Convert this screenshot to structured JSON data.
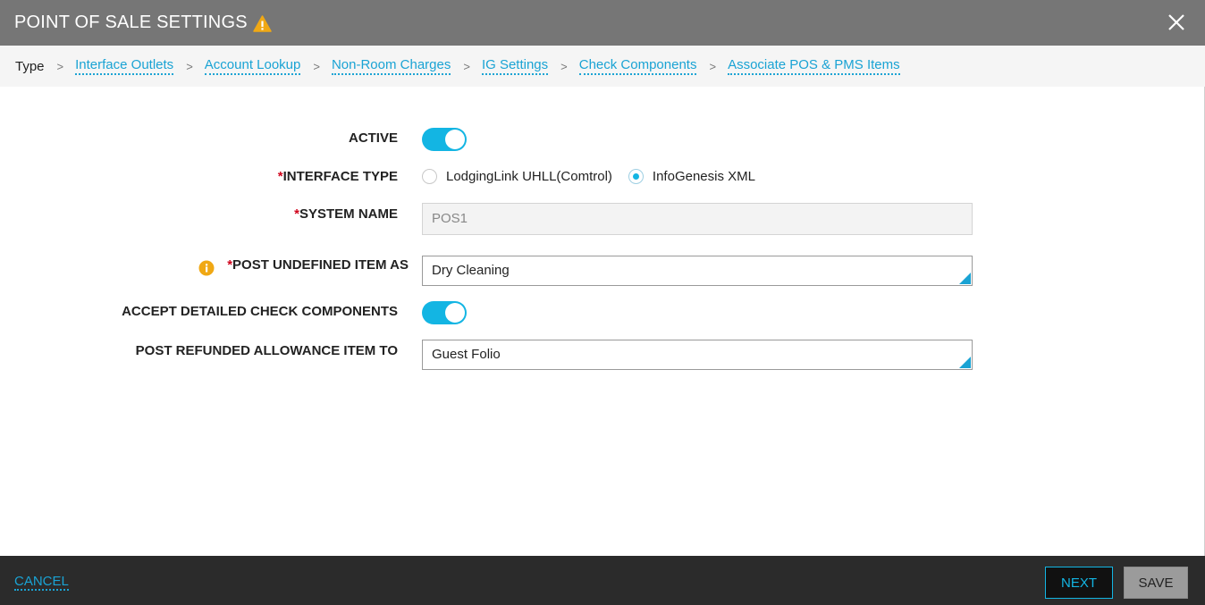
{
  "dialog": {
    "title": "POINT OF SALE SETTINGS",
    "warning_icon": "warning-triangle-icon",
    "close_icon": "close-icon"
  },
  "breadcrumb": {
    "current": "Type",
    "separator": ">",
    "links": [
      "Interface Outlets",
      "Account Lookup",
      "Non-Room Charges",
      "IG Settings",
      "Check Components",
      "Associate POS & PMS Items"
    ]
  },
  "form": {
    "active": {
      "label": "ACTIVE",
      "on": true
    },
    "interface_type": {
      "required_mark": "*",
      "label": "INTERFACE TYPE",
      "options": [
        {
          "label": "LodgingLink UHLL(Comtrol)",
          "selected": false
        },
        {
          "label": "InfoGenesis XML",
          "selected": true
        }
      ]
    },
    "system_name": {
      "required_mark": "*",
      "label": "SYSTEM NAME",
      "value": "POS1"
    },
    "post_undefined_item": {
      "required_mark": "*",
      "label": "POST UNDEFINED ITEM AS",
      "value": "Dry Cleaning",
      "info_icon": "info-icon"
    },
    "accept_detailed": {
      "label": "ACCEPT DETAILED CHECK COMPONENTS",
      "on": true
    },
    "post_refunded": {
      "label": "POST REFUNDED ALLOWANCE ITEM TO",
      "value": "Guest Folio"
    }
  },
  "footer": {
    "cancel_label": "CANCEL",
    "next_label": "NEXT",
    "save_label": "SAVE"
  },
  "colors": {
    "header_bg": "#767676",
    "accent": "#13b5e3",
    "link": "#1aa3d4",
    "required": "#d0021b",
    "warning": "#f0a814",
    "footer_bg": "#2b2b2b"
  }
}
